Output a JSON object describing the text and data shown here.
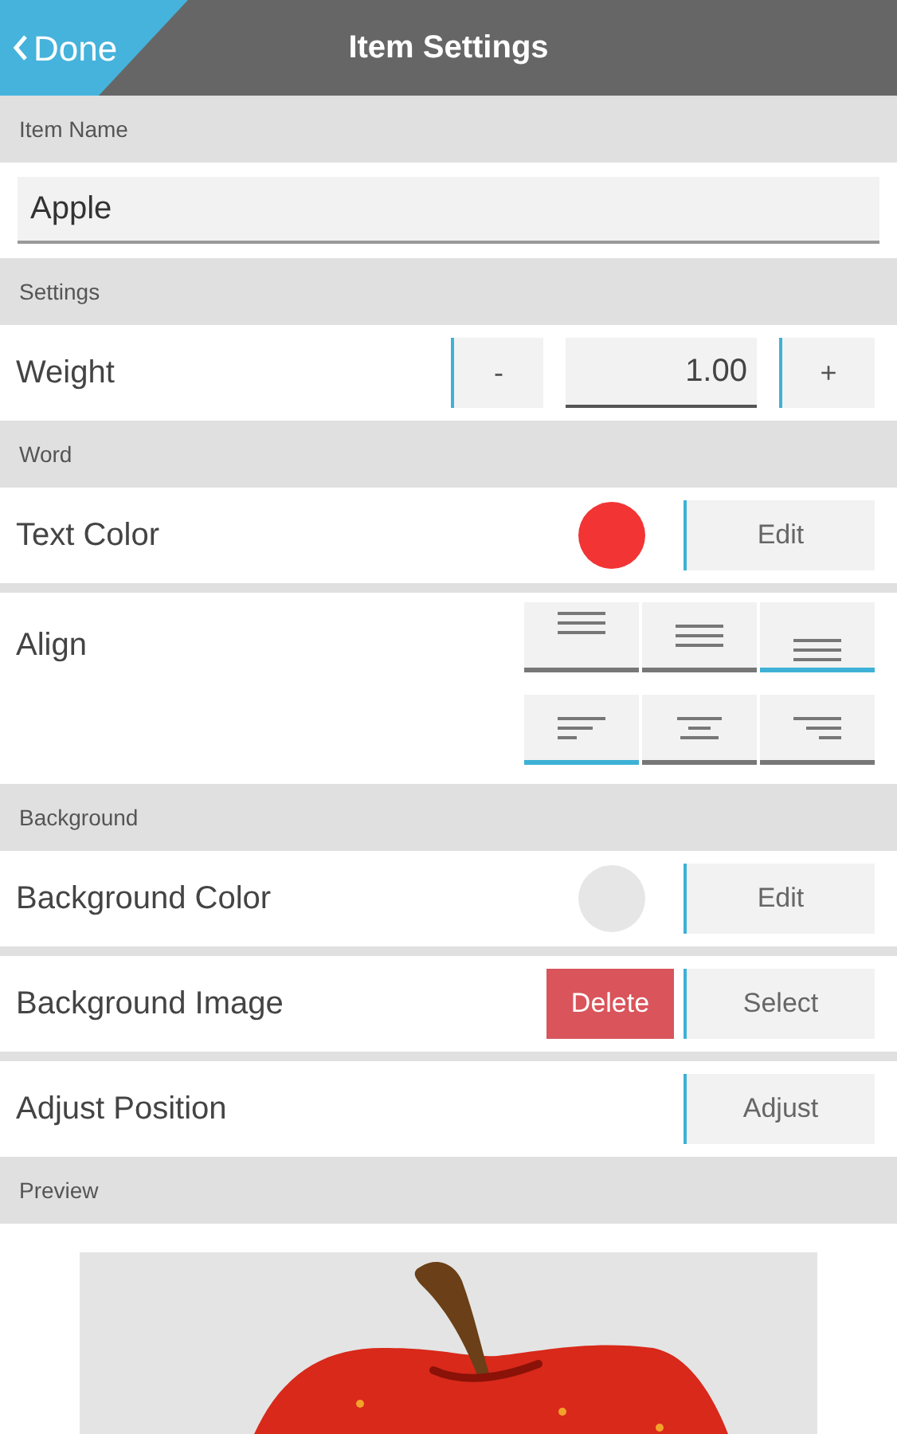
{
  "header": {
    "back": "Done",
    "title": "Item Settings"
  },
  "sections": [
    {
      "label": "Item Name",
      "rows": [
        {
          "kind": "text_field",
          "value": "Apple"
        }
      ]
    },
    {
      "label": "Settings",
      "rows": [
        {
          "kind": "stepper",
          "label": "Weight",
          "minus": "-",
          "value": "1.00",
          "plus": "+"
        }
      ]
    },
    {
      "label": "Word",
      "rows": [
        {
          "kind": "color",
          "label": "Text Color",
          "color": "#f23434",
          "button": "Edit"
        },
        {
          "kind": "align",
          "label": "Align",
          "vertical": [
            {
              "kind": "top",
              "selected": false
            },
            {
              "kind": "middle",
              "selected": false
            },
            {
              "kind": "bottom",
              "selected": true
            }
          ],
          "horizontal": [
            {
              "kind": "left",
              "selected": true
            },
            {
              "kind": "center",
              "selected": false
            },
            {
              "kind": "right",
              "selected": false
            }
          ]
        }
      ]
    },
    {
      "label": "Background",
      "rows": [
        {
          "kind": "color",
          "label": "Background Color",
          "color": "#e6e6e6",
          "button": "Edit"
        },
        {
          "kind": "buttons",
          "label": "Background Image",
          "buttons": [
            {
              "label": "Delete",
              "kind": "danger"
            },
            {
              "label": "Select",
              "kind": "normal"
            }
          ]
        },
        {
          "kind": "buttons",
          "label": "Adjust Position",
          "buttons": [
            {
              "label": "Adjust",
              "kind": "normal"
            }
          ]
        }
      ]
    },
    {
      "label": "Preview",
      "rows": [
        {
          "kind": "preview"
        }
      ]
    }
  ]
}
